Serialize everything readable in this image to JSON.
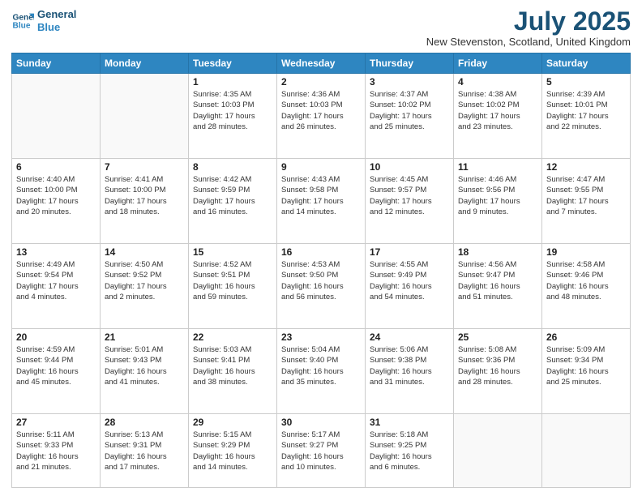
{
  "header": {
    "logo_line1": "General",
    "logo_line2": "Blue",
    "title": "July 2025",
    "location": "New Stevenston, Scotland, United Kingdom"
  },
  "days_of_week": [
    "Sunday",
    "Monday",
    "Tuesday",
    "Wednesday",
    "Thursday",
    "Friday",
    "Saturday"
  ],
  "weeks": [
    [
      {
        "num": "",
        "info": ""
      },
      {
        "num": "",
        "info": ""
      },
      {
        "num": "1",
        "info": "Sunrise: 4:35 AM\nSunset: 10:03 PM\nDaylight: 17 hours\nand 28 minutes."
      },
      {
        "num": "2",
        "info": "Sunrise: 4:36 AM\nSunset: 10:03 PM\nDaylight: 17 hours\nand 26 minutes."
      },
      {
        "num": "3",
        "info": "Sunrise: 4:37 AM\nSunset: 10:02 PM\nDaylight: 17 hours\nand 25 minutes."
      },
      {
        "num": "4",
        "info": "Sunrise: 4:38 AM\nSunset: 10:02 PM\nDaylight: 17 hours\nand 23 minutes."
      },
      {
        "num": "5",
        "info": "Sunrise: 4:39 AM\nSunset: 10:01 PM\nDaylight: 17 hours\nand 22 minutes."
      }
    ],
    [
      {
        "num": "6",
        "info": "Sunrise: 4:40 AM\nSunset: 10:00 PM\nDaylight: 17 hours\nand 20 minutes."
      },
      {
        "num": "7",
        "info": "Sunrise: 4:41 AM\nSunset: 10:00 PM\nDaylight: 17 hours\nand 18 minutes."
      },
      {
        "num": "8",
        "info": "Sunrise: 4:42 AM\nSunset: 9:59 PM\nDaylight: 17 hours\nand 16 minutes."
      },
      {
        "num": "9",
        "info": "Sunrise: 4:43 AM\nSunset: 9:58 PM\nDaylight: 17 hours\nand 14 minutes."
      },
      {
        "num": "10",
        "info": "Sunrise: 4:45 AM\nSunset: 9:57 PM\nDaylight: 17 hours\nand 12 minutes."
      },
      {
        "num": "11",
        "info": "Sunrise: 4:46 AM\nSunset: 9:56 PM\nDaylight: 17 hours\nand 9 minutes."
      },
      {
        "num": "12",
        "info": "Sunrise: 4:47 AM\nSunset: 9:55 PM\nDaylight: 17 hours\nand 7 minutes."
      }
    ],
    [
      {
        "num": "13",
        "info": "Sunrise: 4:49 AM\nSunset: 9:54 PM\nDaylight: 17 hours\nand 4 minutes."
      },
      {
        "num": "14",
        "info": "Sunrise: 4:50 AM\nSunset: 9:52 PM\nDaylight: 17 hours\nand 2 minutes."
      },
      {
        "num": "15",
        "info": "Sunrise: 4:52 AM\nSunset: 9:51 PM\nDaylight: 16 hours\nand 59 minutes."
      },
      {
        "num": "16",
        "info": "Sunrise: 4:53 AM\nSunset: 9:50 PM\nDaylight: 16 hours\nand 56 minutes."
      },
      {
        "num": "17",
        "info": "Sunrise: 4:55 AM\nSunset: 9:49 PM\nDaylight: 16 hours\nand 54 minutes."
      },
      {
        "num": "18",
        "info": "Sunrise: 4:56 AM\nSunset: 9:47 PM\nDaylight: 16 hours\nand 51 minutes."
      },
      {
        "num": "19",
        "info": "Sunrise: 4:58 AM\nSunset: 9:46 PM\nDaylight: 16 hours\nand 48 minutes."
      }
    ],
    [
      {
        "num": "20",
        "info": "Sunrise: 4:59 AM\nSunset: 9:44 PM\nDaylight: 16 hours\nand 45 minutes."
      },
      {
        "num": "21",
        "info": "Sunrise: 5:01 AM\nSunset: 9:43 PM\nDaylight: 16 hours\nand 41 minutes."
      },
      {
        "num": "22",
        "info": "Sunrise: 5:03 AM\nSunset: 9:41 PM\nDaylight: 16 hours\nand 38 minutes."
      },
      {
        "num": "23",
        "info": "Sunrise: 5:04 AM\nSunset: 9:40 PM\nDaylight: 16 hours\nand 35 minutes."
      },
      {
        "num": "24",
        "info": "Sunrise: 5:06 AM\nSunset: 9:38 PM\nDaylight: 16 hours\nand 31 minutes."
      },
      {
        "num": "25",
        "info": "Sunrise: 5:08 AM\nSunset: 9:36 PM\nDaylight: 16 hours\nand 28 minutes."
      },
      {
        "num": "26",
        "info": "Sunrise: 5:09 AM\nSunset: 9:34 PM\nDaylight: 16 hours\nand 25 minutes."
      }
    ],
    [
      {
        "num": "27",
        "info": "Sunrise: 5:11 AM\nSunset: 9:33 PM\nDaylight: 16 hours\nand 21 minutes."
      },
      {
        "num": "28",
        "info": "Sunrise: 5:13 AM\nSunset: 9:31 PM\nDaylight: 16 hours\nand 17 minutes."
      },
      {
        "num": "29",
        "info": "Sunrise: 5:15 AM\nSunset: 9:29 PM\nDaylight: 16 hours\nand 14 minutes."
      },
      {
        "num": "30",
        "info": "Sunrise: 5:17 AM\nSunset: 9:27 PM\nDaylight: 16 hours\nand 10 minutes."
      },
      {
        "num": "31",
        "info": "Sunrise: 5:18 AM\nSunset: 9:25 PM\nDaylight: 16 hours\nand 6 minutes."
      },
      {
        "num": "",
        "info": ""
      },
      {
        "num": "",
        "info": ""
      }
    ]
  ]
}
